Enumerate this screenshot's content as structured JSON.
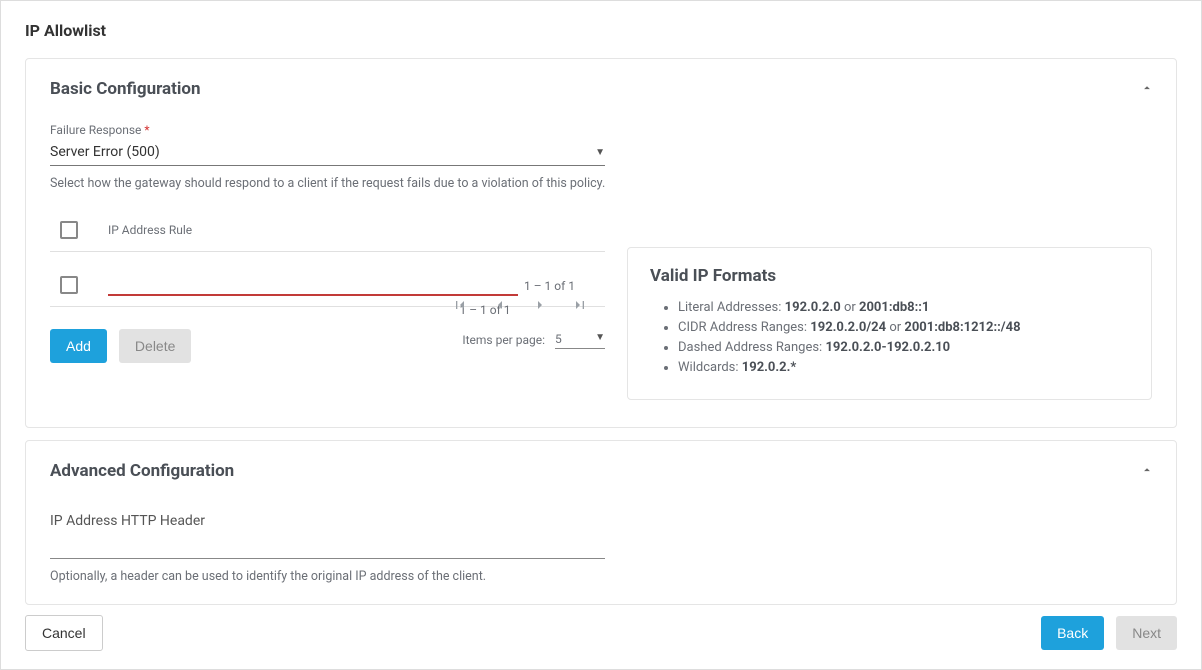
{
  "page": {
    "title": "IP Allowlist"
  },
  "basic": {
    "title": "Basic Configuration",
    "failure_label": "Failure Response",
    "failure_value": "Server Error (500)",
    "failure_help": "Select how the gateway should respond to a client if the request fails due to a violation of this policy.",
    "table": {
      "col_label": "IP Address Rule",
      "row_value": "",
      "pager_text": "1 – 1 of 1",
      "items_per_page_label": "Items per page:",
      "items_per_page_value": "5"
    },
    "buttons": {
      "add": "Add",
      "delete": "Delete"
    }
  },
  "valid_formats": {
    "title": "Valid IP Formats",
    "items": [
      {
        "label": "Literal Addresses:",
        "ex1": "192.0.2.0",
        "or": "or",
        "ex2": "2001:db8::1"
      },
      {
        "label": "CIDR Address Ranges:",
        "ex1": "192.0.2.0/24",
        "or": "or",
        "ex2": "2001:db8:1212::/48"
      },
      {
        "label": "Dashed Address Ranges:",
        "ex1": "192.0.2.0-192.0.2.10"
      },
      {
        "label": "Wildcards:",
        "ex1": "192.0.2.*"
      }
    ]
  },
  "advanced": {
    "title": "Advanced Configuration",
    "header_label": "IP Address HTTP Header",
    "header_value": "",
    "header_help": "Optionally, a header can be used to identify the original IP address of the client."
  },
  "footer": {
    "cancel": "Cancel",
    "back": "Back",
    "next": "Next"
  }
}
